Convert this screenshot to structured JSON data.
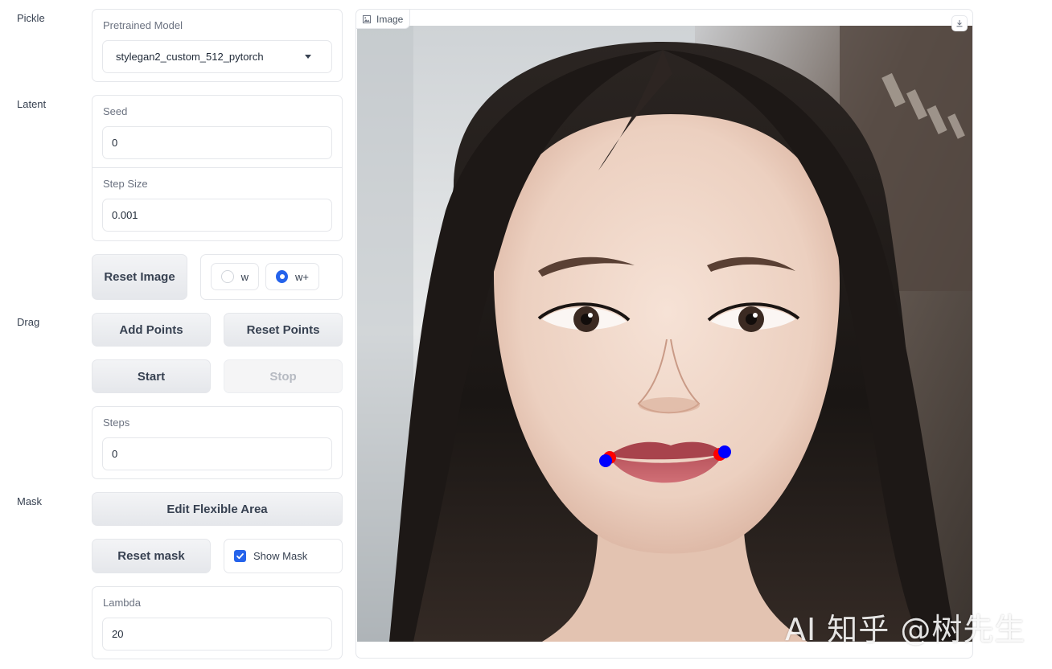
{
  "sections": {
    "pickle": "Pickle",
    "latent": "Latent",
    "drag": "Drag",
    "mask": "Mask"
  },
  "pretrained_model": {
    "label": "Pretrained Model",
    "value": "stylegan2_custom_512_pytorch"
  },
  "latent": {
    "seed_label": "Seed",
    "seed_value": "0",
    "step_size_label": "Step Size",
    "step_size_value": "0.001"
  },
  "reset_image_label": "Reset Image",
  "latent_space": {
    "options": [
      "w",
      "w+"
    ],
    "selected": "w+"
  },
  "drag": {
    "add_points_label": "Add Points",
    "reset_points_label": "Reset Points",
    "start_label": "Start",
    "stop_label": "Stop",
    "steps_label": "Steps",
    "steps_value": "0"
  },
  "mask": {
    "edit_flexible_area_label": "Edit Flexible Area",
    "reset_mask_label": "Reset mask",
    "show_mask_label": "Show Mask",
    "show_mask_checked": true,
    "lambda_label": "Lambda",
    "lambda_value": "20"
  },
  "image": {
    "tag_label": "Image",
    "handle_point_color": "#ff0000",
    "target_point_color": "#0000ff"
  },
  "watermark": "AI 知乎 @树先生"
}
